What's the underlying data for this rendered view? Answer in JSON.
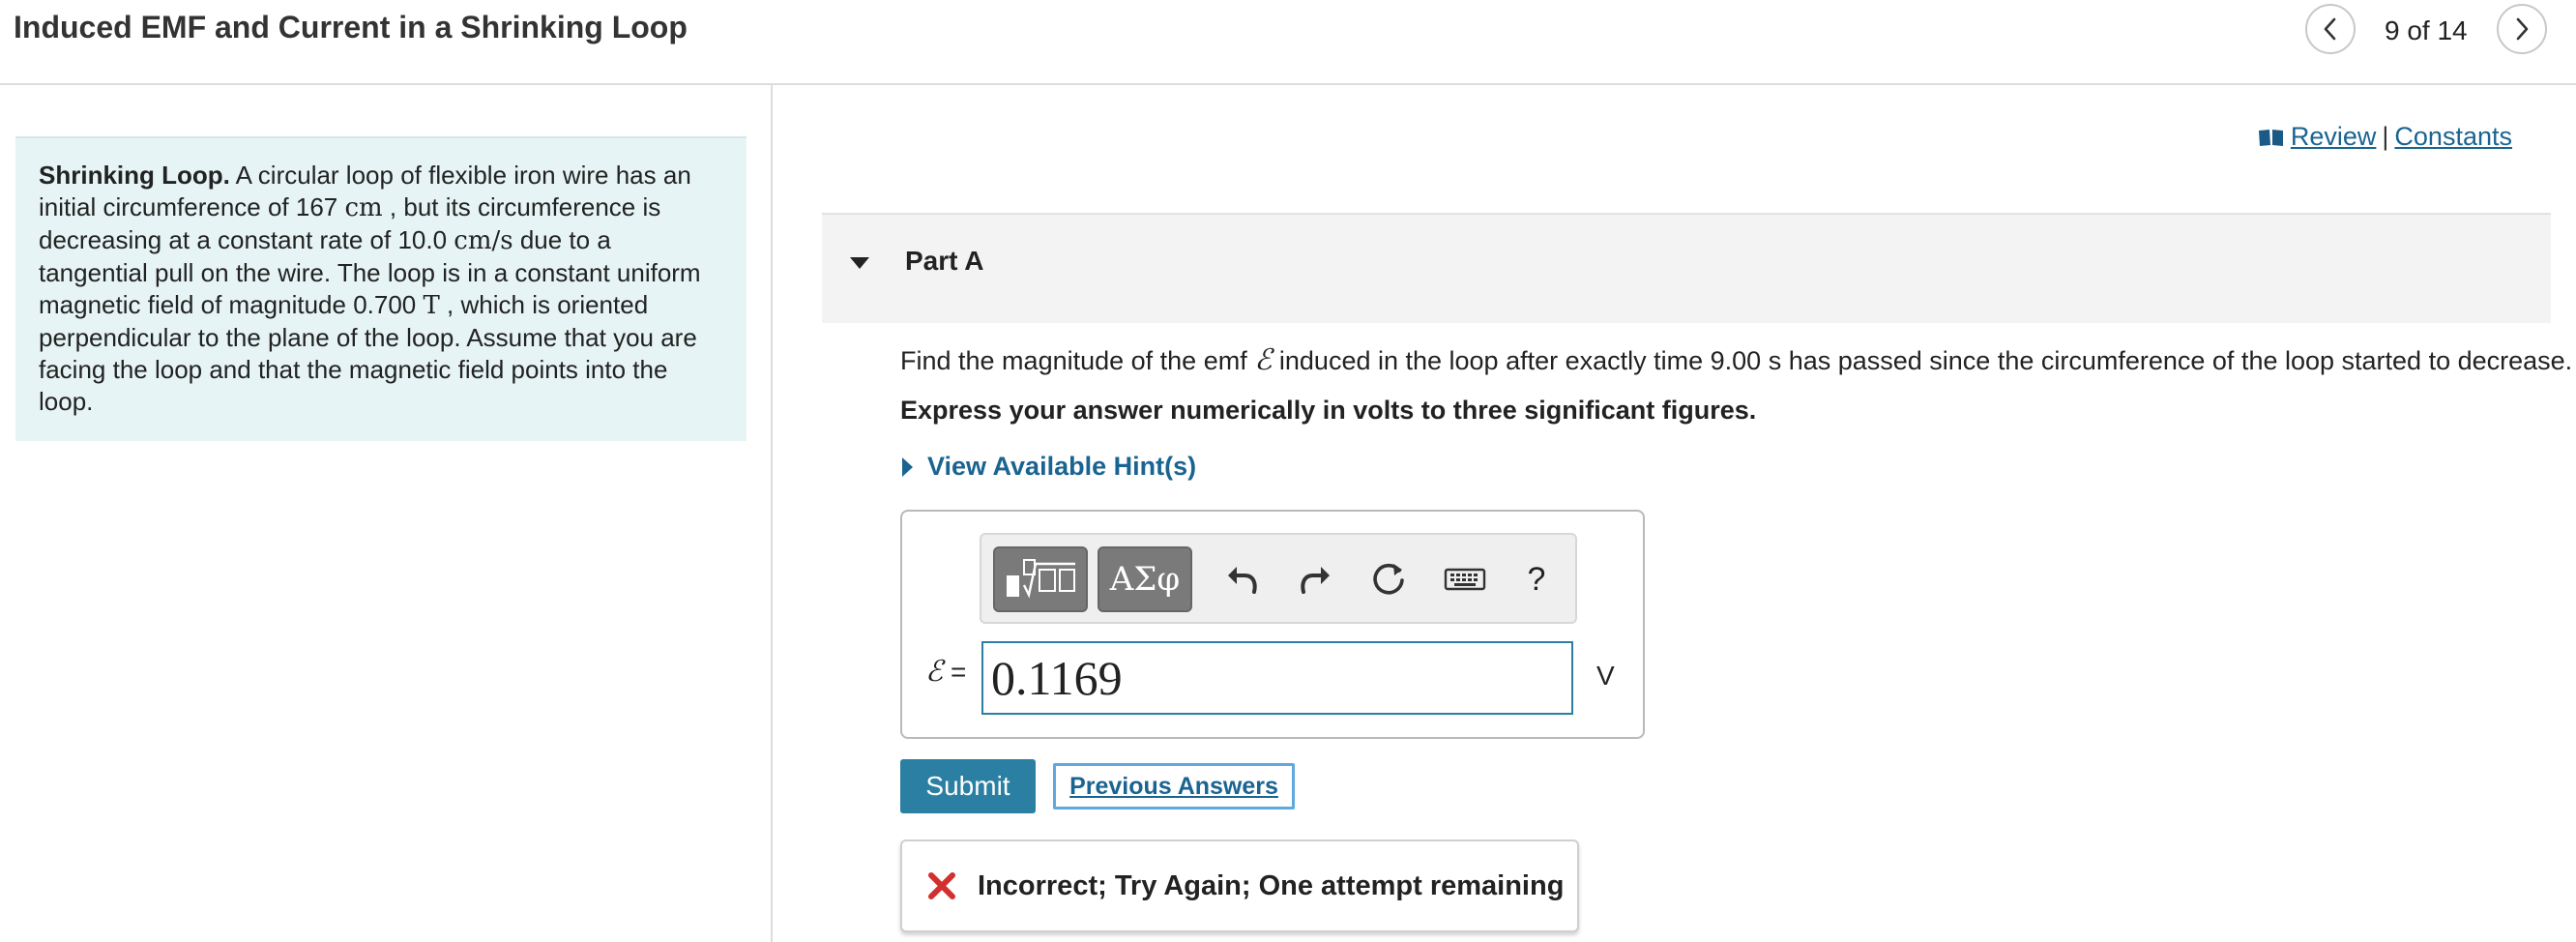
{
  "header": {
    "title": "Induced EMF and Current in a Shrinking Loop",
    "position": "9 of 14"
  },
  "problem": {
    "lead": "Shrinking Loop.",
    "t1": " A circular loop of flexible iron wire has an initial circumference of 167 ",
    "u1": "cm",
    "t2": " , but its circumference is decreasing at a constant rate of 10.0 ",
    "u2": "cm/s",
    "t3": " due to a tangential pull on the wire. The loop is in a constant uniform magnetic field of magnitude 0.700 ",
    "u3": "T",
    "t4": " , which is oriented perpendicular to the plane of the loop. Assume that you are facing the loop and that the magnetic field points into the loop."
  },
  "links": {
    "review": "Review",
    "separator": "|",
    "constants": "Constants"
  },
  "part": {
    "title": "Part A",
    "question_pre": "Find the magnitude of the emf ",
    "emf_symbol": "ℰ",
    "question_post": " induced in the loop after exactly time 9.00 s has passed since the circumference of the loop started to decrease.",
    "instruction": "Express your answer numerically in volts to three significant figures.",
    "hints_label": "View Available Hint(s)"
  },
  "answer": {
    "label_equals": " =",
    "value": "0.1169",
    "unit": "V",
    "greek_button": "ΑΣφ",
    "help_button": "?"
  },
  "buttons": {
    "submit": "Submit",
    "previous_answers": "Previous Answers"
  },
  "feedback": {
    "text": "Incorrect; Try Again; One attempt remaining",
    "icon": "x-mark-icon",
    "color": "#d32f2f"
  },
  "colors": {
    "accent": "#2a7fa3",
    "link": "#1a6491",
    "problem_bg": "#e6f4f5"
  }
}
